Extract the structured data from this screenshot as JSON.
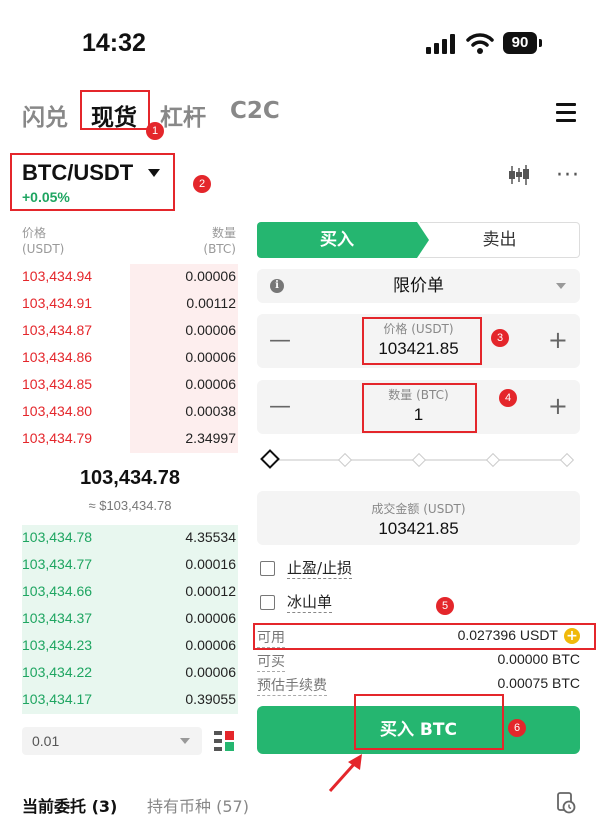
{
  "status_bar": {
    "time": "14:32",
    "battery": "90"
  },
  "top_tabs": [
    {
      "label": "闪兑",
      "active": false
    },
    {
      "label": "现货",
      "active": true
    },
    {
      "label": "杠杆",
      "active": false
    },
    {
      "label": "C2C",
      "active": false
    }
  ],
  "pair": {
    "symbol": "BTC/USDT",
    "change": "+0.05%"
  },
  "orderbook": {
    "price_header": "价格",
    "price_unit": "(USDT)",
    "qty_header": "数量",
    "qty_unit": "(BTC)",
    "asks": [
      {
        "price": "103,434.94",
        "qty": "0.00006",
        "depth": 0.5
      },
      {
        "price": "103,434.91",
        "qty": "0.00112",
        "depth": 0.5
      },
      {
        "price": "103,434.87",
        "qty": "0.00006",
        "depth": 0.5
      },
      {
        "price": "103,434.86",
        "qty": "0.00006",
        "depth": 0.5
      },
      {
        "price": "103,434.85",
        "qty": "0.00006",
        "depth": 0.5
      },
      {
        "price": "103,434.80",
        "qty": "0.00038",
        "depth": 0.5
      },
      {
        "price": "103,434.79",
        "qty": "2.34997",
        "depth": 0.5
      }
    ],
    "last_price": "103,434.78",
    "last_price_usd": "≈ $103,434.78",
    "bids": [
      {
        "price": "103,434.78",
        "qty": "4.35534",
        "depth": 1.0
      },
      {
        "price": "103,434.77",
        "qty": "0.00016",
        "depth": 1.0
      },
      {
        "price": "103,434.66",
        "qty": "0.00012",
        "depth": 1.0
      },
      {
        "price": "103,434.37",
        "qty": "0.00006",
        "depth": 1.0
      },
      {
        "price": "103,434.23",
        "qty": "0.00006",
        "depth": 1.0
      },
      {
        "price": "103,434.22",
        "qty": "0.00006",
        "depth": 1.0
      },
      {
        "price": "103,434.17",
        "qty": "0.39055",
        "depth": 1.0
      }
    ],
    "depth_precision": "0.01"
  },
  "trade_form": {
    "buy_tab": "买入",
    "sell_tab": "卖出",
    "order_type": "限价单",
    "price_label": "价格 (USDT)",
    "price_value": "103421.85",
    "qty_label": "数量 (BTC)",
    "qty_value": "1",
    "total_label": "成交金额 (USDT)",
    "total_value": "103421.85",
    "tp_sl": "止盈/止损",
    "iceberg": "冰山单",
    "available_label": "可用",
    "available_value": "0.027396 USDT",
    "can_buy_label": "可买",
    "can_buy_value": "0.00000 BTC",
    "fee_label": "预估手续费",
    "fee_value": "0.00075 BTC",
    "submit": "买入 BTC"
  },
  "annotations": [
    "1",
    "2",
    "3",
    "4",
    "5",
    "6"
  ],
  "bottom_tabs": [
    {
      "label": "当前委托 (3)",
      "active": true
    },
    {
      "label": "持有币种 (57)",
      "active": false
    }
  ],
  "colors": {
    "green": "#25b670",
    "red": "#e4262b",
    "highlight": "#e4262b"
  }
}
